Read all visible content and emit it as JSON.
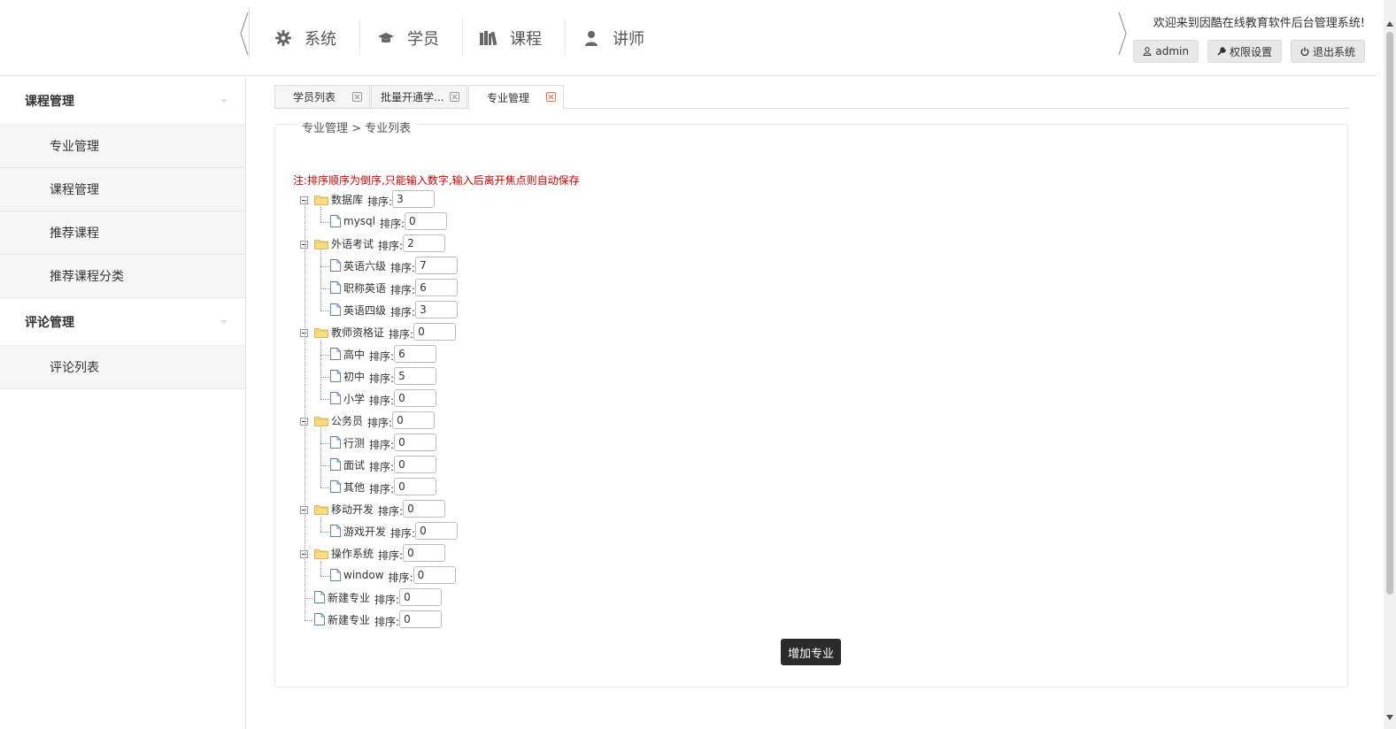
{
  "header": {
    "nav": [
      {
        "label": "系统",
        "icon": "gear-icon"
      },
      {
        "label": "学员",
        "icon": "graduation-cap-icon"
      },
      {
        "label": "课程",
        "icon": "books-icon"
      },
      {
        "label": "讲师",
        "icon": "user-icon"
      }
    ],
    "welcome": "欢迎来到因酷在线教育软件后台管理系统!",
    "buttons": {
      "admin": "admin",
      "permissions": "权限设置",
      "logout": "退出系统"
    }
  },
  "sidebar": {
    "groups": [
      {
        "label": "课程管理",
        "items": [
          "专业管理",
          "课程管理",
          "推荐课程",
          "推荐课程分类"
        ]
      },
      {
        "label": "评论管理",
        "items": [
          "评论列表"
        ]
      }
    ]
  },
  "tabs": [
    {
      "label": "学员列表",
      "active": false
    },
    {
      "label": "批量开通学...",
      "active": false
    },
    {
      "label": "专业管理",
      "active": true
    }
  ],
  "breadcrumb": "专业管理 > 专业列表",
  "note": "注:排序顺序为倒序,只能输入数字,输入后离开焦点则自动保存",
  "sort_label": "排序:",
  "tree": [
    {
      "name": "数据库",
      "sort": "3",
      "children": [
        {
          "name": "mysql",
          "sort": "0"
        }
      ]
    },
    {
      "name": "外语考试",
      "sort": "2",
      "children": [
        {
          "name": "英语六级",
          "sort": "7"
        },
        {
          "name": "职称英语",
          "sort": "6"
        },
        {
          "name": "英语四级",
          "sort": "3"
        }
      ]
    },
    {
      "name": "教师资格证",
      "sort": "0",
      "children": [
        {
          "name": "高中",
          "sort": "6"
        },
        {
          "name": "初中",
          "sort": "5"
        },
        {
          "name": "小学",
          "sort": "0"
        }
      ]
    },
    {
      "name": "公务员",
      "sort": "0",
      "children": [
        {
          "name": "行测",
          "sort": "0"
        },
        {
          "name": "面试",
          "sort": "0"
        },
        {
          "name": "其他",
          "sort": "0"
        }
      ]
    },
    {
      "name": "移动开发",
      "sort": "0",
      "children": [
        {
          "name": "游戏开发",
          "sort": "0"
        }
      ]
    },
    {
      "name": "操作系统",
      "sort": "0",
      "children": [
        {
          "name": "window",
          "sort": "0"
        }
      ]
    },
    {
      "name": "新建专业",
      "sort": "0",
      "children": []
    },
    {
      "name": "新建专业",
      "sort": "0",
      "children": []
    }
  ],
  "add_button": "增加专业",
  "colors": {
    "note": "#cc0000",
    "button": "#2b2b2b",
    "tab_close_active": "#e0784a",
    "folder": "#f5d77a"
  }
}
